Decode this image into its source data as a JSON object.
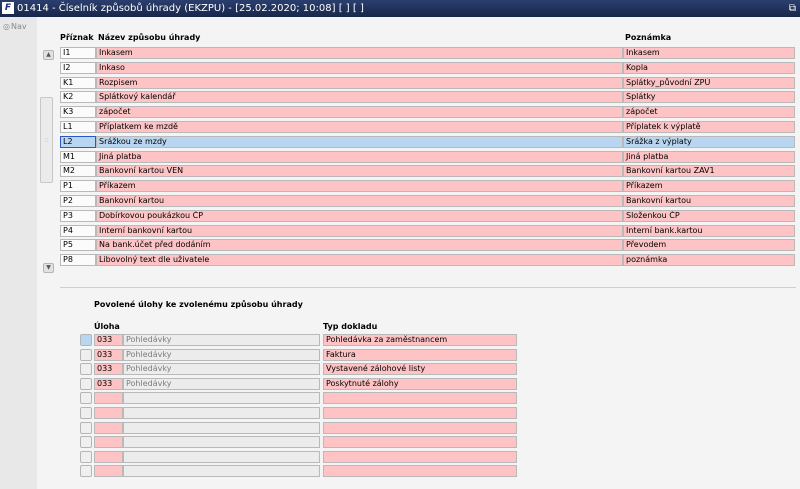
{
  "window": {
    "title": "01414 - Číselník způsobů úhrady (EKZPU) - [25.02.2020; 10:08]  [ ]  [ ]",
    "app_icon_text": "F"
  },
  "nav": {
    "label": "Nav"
  },
  "grid": {
    "columns": {
      "code": "Příznak",
      "name": "Název způsobu úhrady",
      "note": "Poznámka"
    },
    "rows": [
      {
        "code": "I1",
        "name": "Inkasem",
        "note": "Inkasem"
      },
      {
        "code": "I2",
        "name": "Inkaso",
        "note": "Kopla"
      },
      {
        "code": "K1",
        "name": "Rozpisem",
        "note": "Splátky_původní ZPÚ"
      },
      {
        "code": "K2",
        "name": "Splátkový kalendář",
        "note": "Splátky"
      },
      {
        "code": "K3",
        "name": "zápočet",
        "note": "zápočet"
      },
      {
        "code": "L1",
        "name": "Příplatkem ke mzdě",
        "note": "Příplatek k výplatě"
      },
      {
        "code": "L2",
        "name": "Srážkou ze mzdy",
        "note": "Srážka z výplaty"
      },
      {
        "code": "M1",
        "name": "Jiná platba",
        "note": "Jiná platba"
      },
      {
        "code": "M2",
        "name": "Bankovní kartou VEN",
        "note": "Bankovní kartou ZAV1"
      },
      {
        "code": "P1",
        "name": "Příkazem",
        "note": "Příkazem"
      },
      {
        "code": "P2",
        "name": "Bankovní kartou",
        "note": "Bankovní kartou"
      },
      {
        "code": "P3",
        "name": "Dobírkovou poukázkou ČP",
        "note": "Složenkou ČP"
      },
      {
        "code": "P4",
        "name": "Interní bankovní kartou",
        "note": "Interní bank.kartou"
      },
      {
        "code": "P5",
        "name": "Na bank.účet před dodáním",
        "note": "Převodem"
      },
      {
        "code": "P8",
        "name": "Libovolný text dle uživatele",
        "note": "poznámka"
      }
    ],
    "selected_index": 6
  },
  "detail": {
    "title": "Povolené úlohy ke zvolenému způsobu úhrady",
    "columns": {
      "task": "Úloha",
      "doc_type": "Typ dokladu"
    },
    "rows": [
      {
        "code": "033",
        "task_name": "Pohledávky",
        "doc_type": "Pohledávka za zaměstnancem"
      },
      {
        "code": "033",
        "task_name": "Pohledávky",
        "doc_type": "Faktura"
      },
      {
        "code": "033",
        "task_name": "Pohledávky",
        "doc_type": "Vystavené zálohové listy"
      },
      {
        "code": "033",
        "task_name": "Pohledávky",
        "doc_type": "Poskytnuté zálohy"
      },
      {
        "code": "",
        "task_name": "",
        "doc_type": ""
      },
      {
        "code": "",
        "task_name": "",
        "doc_type": ""
      },
      {
        "code": "",
        "task_name": "",
        "doc_type": ""
      },
      {
        "code": "",
        "task_name": "",
        "doc_type": ""
      },
      {
        "code": "",
        "task_name": "",
        "doc_type": ""
      },
      {
        "code": "",
        "task_name": "",
        "doc_type": ""
      }
    ],
    "selected_index": 0
  },
  "colors": {
    "required_field": "#fdc3c5",
    "selected_row": "#b8d6f2",
    "titlebar": "#1f2f5a"
  }
}
